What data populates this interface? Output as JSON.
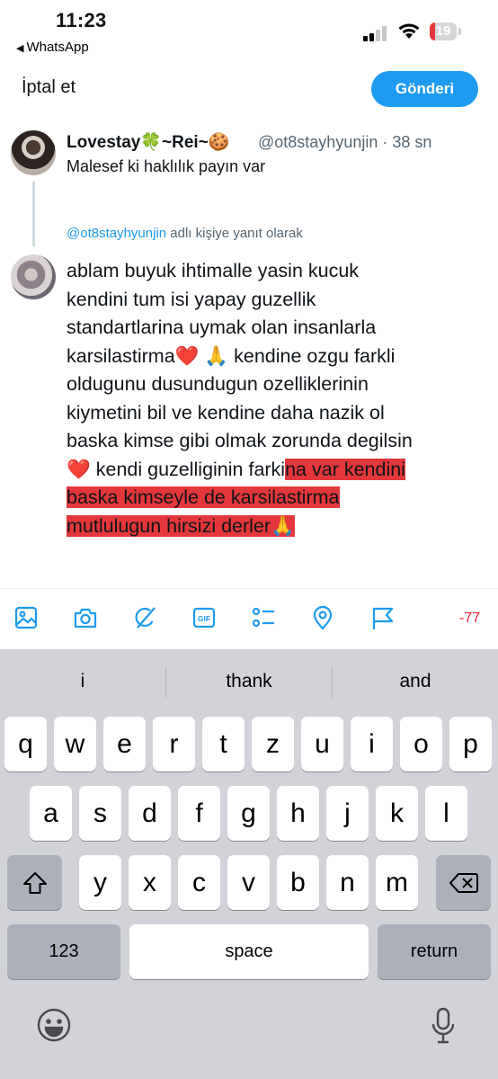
{
  "status_bar": {
    "time": "11:23",
    "back_app": "WhatsApp",
    "battery_level": "19"
  },
  "header": {
    "cancel_label": "İptal et",
    "send_label": "Gönderi"
  },
  "original_tweet": {
    "display_name": "Lovestay🍀~Rei~🍪",
    "handle_time": "@ot8stayhyunjin · 38 sn",
    "text": "Malesef ki haklılık payın var"
  },
  "reply_context": {
    "mention": "@ot8stayhyunjin",
    "suffix": " adlı kişiye yanıt olarak"
  },
  "compose": {
    "lines": [
      {
        "text": "ablam buyuk ihtimalle yasin kucuk"
      },
      {
        "text": "kendini tum isi yapay guzellik"
      },
      {
        "text": "standartlarina uymak olan insanlarla"
      },
      {
        "text": "karsilastirma❤️ 🙏 kendine ozgu farkli"
      },
      {
        "text": "oldugunu dusundugun ozelliklerinin"
      },
      {
        "text": "kiymetini bil ve kendine daha nazik ol"
      },
      {
        "text": "baska kimse gibi olmak zorunda degilsin"
      },
      {
        "text": "❤️  kendi guzelliginin farki",
        "highlighted": "na var kendini"
      },
      {
        "text": "",
        "highlighted": "baska kimseyle de karsilastirma"
      },
      {
        "text": "",
        "highlighted": "mutlulugun hirsizi derler🙏"
      }
    ],
    "highlight_color": "#e3373c"
  },
  "toolbar": {
    "icons": [
      "image-icon",
      "camera-icon",
      "grok-icon",
      "gif-icon",
      "poll-icon",
      "location-icon",
      "flag-icon"
    ],
    "char_count": "-77",
    "accent": "#1d9bf0"
  },
  "keyboard": {
    "suggestions": [
      "i",
      "thank",
      "and"
    ],
    "row1": [
      "q",
      "w",
      "e",
      "r",
      "t",
      "z",
      "u",
      "i",
      "o",
      "p"
    ],
    "row2": [
      "a",
      "s",
      "d",
      "f",
      "g",
      "h",
      "j",
      "k",
      "l"
    ],
    "row3": [
      "y",
      "x",
      "c",
      "v",
      "b",
      "n",
      "m"
    ],
    "numbers_label": "123",
    "space_label": "space",
    "return_label": "return"
  }
}
